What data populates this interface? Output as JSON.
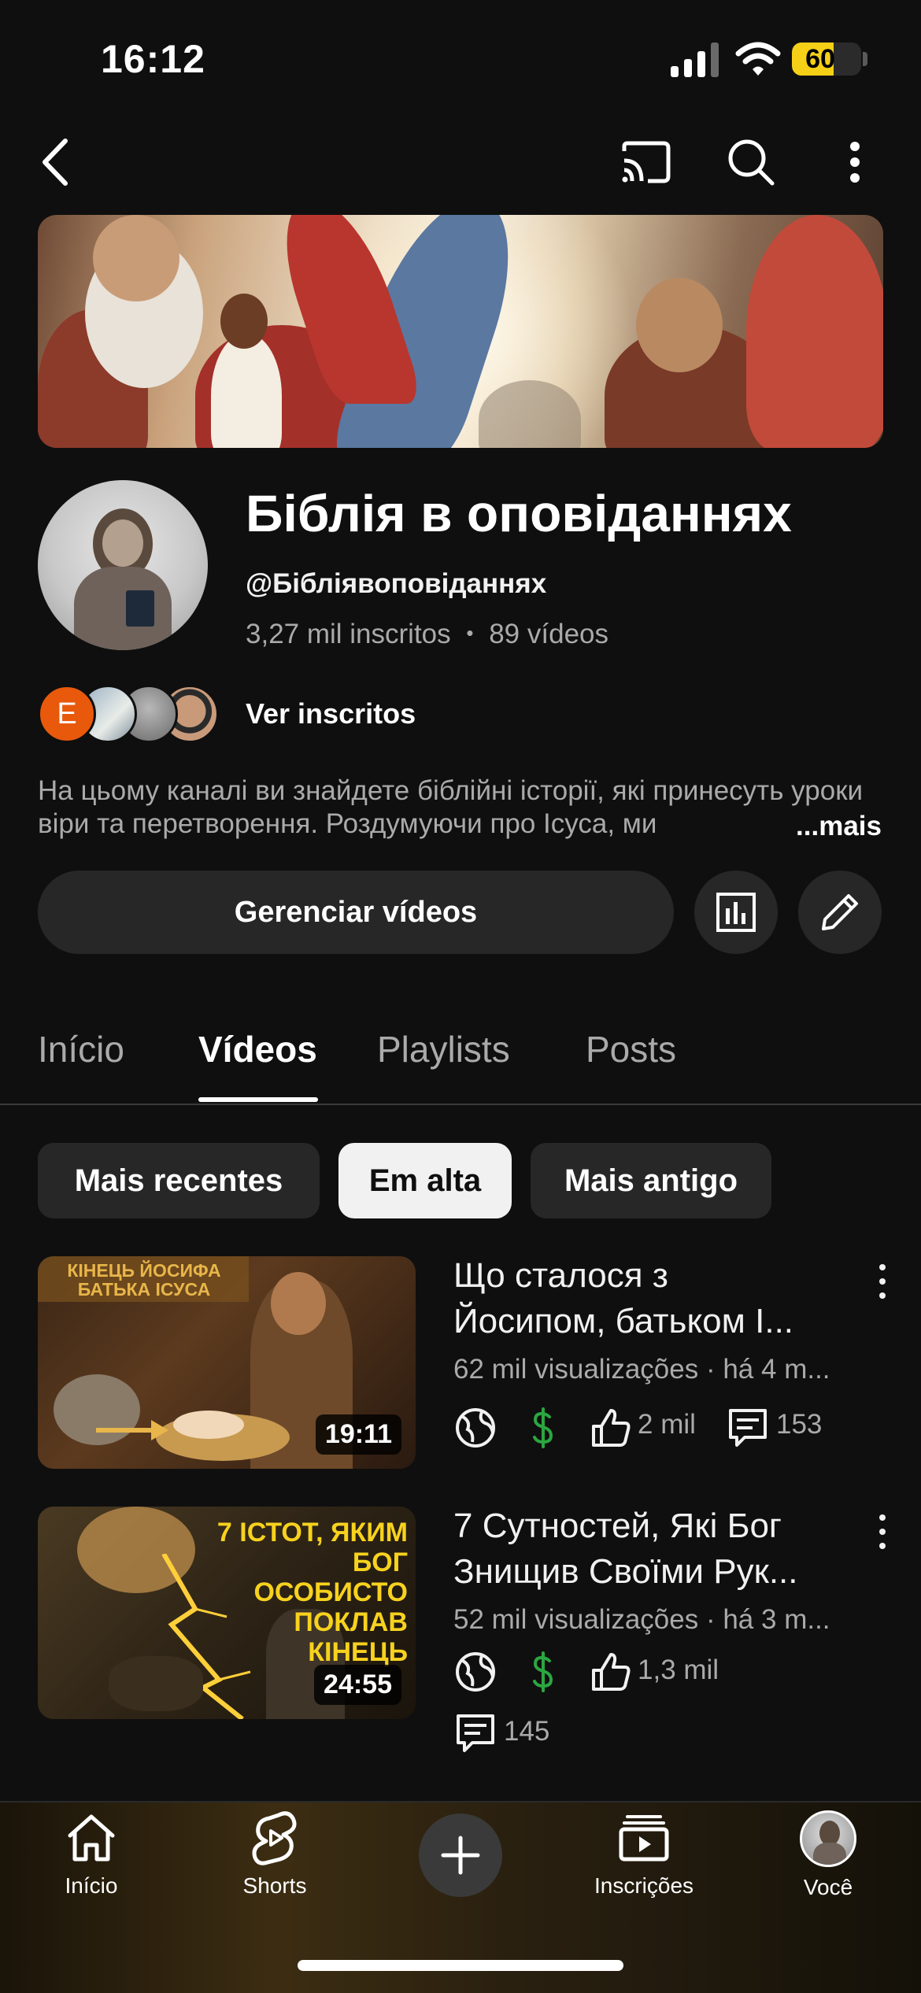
{
  "status_bar": {
    "time": "16:12",
    "battery": "60",
    "battery_level": 0.6
  },
  "top_bar": {
    "icons": [
      "back-icon",
      "cast-icon",
      "search-icon",
      "more-vert-icon"
    ]
  },
  "channel": {
    "name": "Біблія в оповіданнях",
    "handle": "@Бібліявоповіданнях",
    "subscribers": "3,27 mil inscritos",
    "separator": "•",
    "videos_count": "89 vídeos",
    "subscribers_link": "Ver inscritos",
    "first_subscriber_initial": "E",
    "description": "На цьому каналі ви знайдете біблійні історії, які принесуть уроки віри та перетворення. Роздумуючи про Ісуса, ми",
    "more_label": "...mais"
  },
  "actions": {
    "manage_label": "Gerenciar vídeos",
    "analytics_icon": "analytics-icon",
    "edit_icon": "pencil-icon"
  },
  "tabs": [
    {
      "label": "Início",
      "active": false
    },
    {
      "label": "Vídeos",
      "active": true
    },
    {
      "label": "Playlists",
      "active": false
    },
    {
      "label": "Posts",
      "active": false
    }
  ],
  "chips": [
    {
      "label": "Mais recentes",
      "selected": false
    },
    {
      "label": "Em alta",
      "selected": true
    },
    {
      "label": "Mais antigo",
      "selected": false
    }
  ],
  "videos": [
    {
      "thumb_text": "КІНЕЦЬ ЙОСИФА БАТЬКА ІСУСА",
      "duration": "19:11",
      "title_line1": "Що сталося з",
      "title_line2": "Йосипом, батьком І...",
      "meta": "62 mil visualizações · há 4 m...",
      "likes": "2 mil",
      "comments": "153"
    },
    {
      "thumb_text_line1": "7 ІСТОТ, ЯКИМ",
      "thumb_text_line2": "БОГ ОСОБИСТО",
      "thumb_text_line3": "ПОКЛАВ КІНЕЦЬ",
      "duration": "24:55",
      "title_line1": "7 Сутностей, Які Бог",
      "title_line2": "Знищив Своїми Рук...",
      "meta": "52 mil visualizações · há 3 m...",
      "likes": "1,3 mil",
      "comments": "145"
    }
  ],
  "bottom_nav": [
    {
      "label": "Início",
      "icon": "home-icon"
    },
    {
      "label": "Shorts",
      "icon": "shorts-icon"
    },
    {
      "label": "",
      "icon": "plus-icon"
    },
    {
      "label": "Inscrições",
      "icon": "subscriptions-icon"
    },
    {
      "label": "Você",
      "icon": "avatar"
    }
  ],
  "colors": {
    "background": "#0f0f0f",
    "chip": "#272727",
    "monetization": "#2ba640",
    "battery": "#f5d017"
  }
}
